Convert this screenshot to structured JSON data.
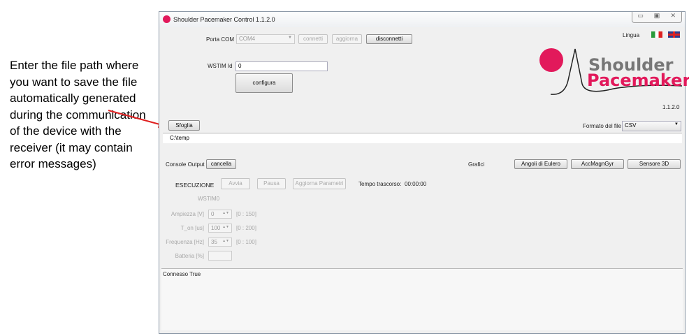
{
  "annotation": {
    "text": "Enter the file path where you want to save the file automatically generated during the communication of the device with the receiver (it may contain error messages)",
    "arrow_color": "#e02020"
  },
  "window": {
    "title": "Shoulder Pacemaker Control 1.1.2.0",
    "controls": [
      "minimize",
      "maximize",
      "close"
    ]
  },
  "connection": {
    "port_label": "Porta COM",
    "port_value": "COM4",
    "connect": "connetti",
    "refresh": "aggiorna",
    "disconnect": "disconnetti"
  },
  "wstim": {
    "label": "WSTIM Id",
    "value": "0",
    "configure": "configura"
  },
  "language": {
    "label": "Lingua",
    "flags": [
      "italian-flag",
      "uk-flag"
    ]
  },
  "logo": {
    "line1": "Shoulder",
    "line2": "Pacemaker",
    "accent": "#e2195b",
    "version": "1.1.2.0"
  },
  "file": {
    "browse": "Sfoglia",
    "format_label": "Formato del file",
    "format_value": "CSV",
    "path": "C:\\temp"
  },
  "console": {
    "label": "Console Output",
    "clear": "cancella",
    "status": "Connesso True"
  },
  "charts": {
    "label": "Grafici",
    "buttons": [
      "Angoli di Eulero",
      "AccMagnGyr",
      "Sensore 3D"
    ]
  },
  "execution": {
    "label": "ESECUZIONE",
    "start": "Avvia",
    "pause": "Pausa",
    "update": "Aggiorna Parametri",
    "elapsed_label": "Tempo trascorso:",
    "elapsed_value": "00:00:00",
    "device": "WSTIM0"
  },
  "params": [
    {
      "label": "Ampiezza [V]",
      "value": "0",
      "range": "[0 : 150]"
    },
    {
      "label": "T_on [us]",
      "value": "100",
      "range": "[0 : 200]"
    },
    {
      "label": "Frequenza [Hz]",
      "value": "35",
      "range": "[0 : 100]"
    }
  ],
  "battery": {
    "label": "Batteria [%]",
    "value": ""
  }
}
